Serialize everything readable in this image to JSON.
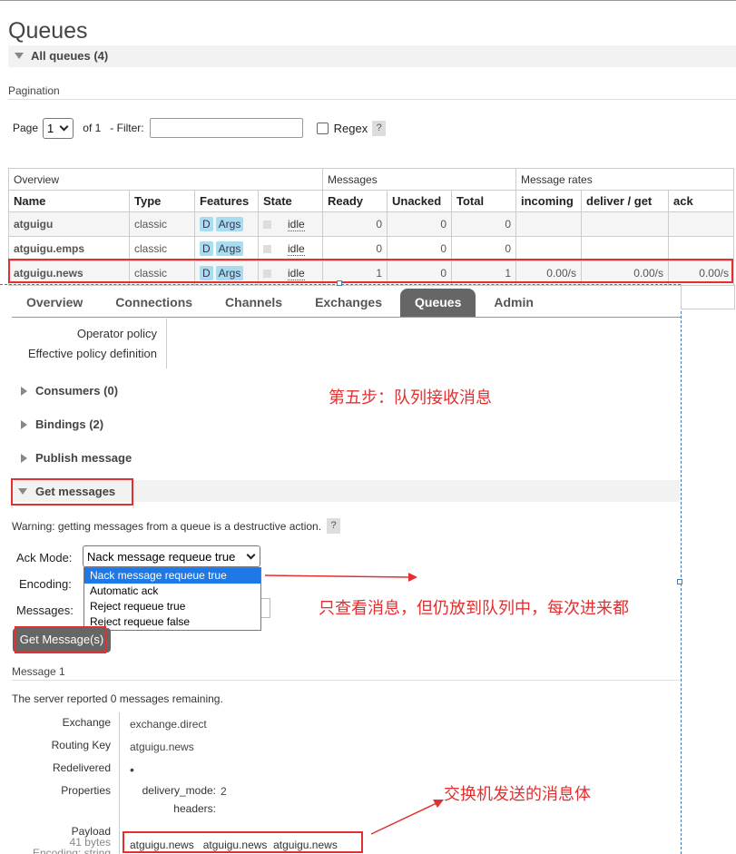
{
  "page": {
    "title": "Queues",
    "all_queues_label": "All queues (4)",
    "pagination_label": "Pagination"
  },
  "pagination": {
    "page_label": "Page",
    "page_value": "1",
    "of_label": "of 1",
    "filter_label": "- Filter:",
    "filter_value": "",
    "regex_label": "Regex",
    "help": "?"
  },
  "table": {
    "groups": [
      "Overview",
      "Messages",
      "Message rates"
    ],
    "headers": [
      "Name",
      "Type",
      "Features",
      "State",
      "Ready",
      "Unacked",
      "Total",
      "incoming",
      "deliver / get",
      "ack"
    ],
    "rows": [
      {
        "name": "atguigu",
        "type": "classic",
        "f1": "D",
        "f2": "Args",
        "state": "idle",
        "ready": "0",
        "unacked": "0",
        "total": "0",
        "incoming": "",
        "deliver": "",
        "ack": ""
      },
      {
        "name": "atguigu.emps",
        "type": "classic",
        "f1": "D",
        "f2": "Args",
        "state": "idle",
        "ready": "0",
        "unacked": "0",
        "total": "0",
        "incoming": "",
        "deliver": "",
        "ack": ""
      },
      {
        "name": "atguigu.news",
        "type": "classic",
        "f1": "D",
        "f2": "Args",
        "state": "idle",
        "ready": "1",
        "unacked": "0",
        "total": "1",
        "incoming": "0.00/s",
        "deliver": "0.00/s",
        "ack": "0.00/s"
      }
    ]
  },
  "nav": {
    "tabs": [
      "Overview",
      "Connections",
      "Channels",
      "Exchanges",
      "Queues",
      "Admin"
    ],
    "active": "Queues"
  },
  "policy": {
    "operator": "Operator policy",
    "effective": "Effective policy definition"
  },
  "sections": {
    "consumers": "Consumers (0)",
    "bindings": "Bindings (2)",
    "publish": "Publish message",
    "get": "Get messages"
  },
  "annotations": {
    "step5": "第五步：队列接收消息",
    "view_only": "只查看消息，但仍放到队列中，每次进来都",
    "exchange_body": "交换机发送的消息体"
  },
  "get_messages": {
    "warning": "Warning: getting messages from a queue is a destructive action.",
    "help": "?",
    "ack_mode_label": "Ack Mode:",
    "ack_mode_value": "Nack message requeue true",
    "options": [
      "Nack message requeue true",
      "Automatic ack",
      "Reject requeue true",
      "Reject requeue false"
    ],
    "encoding_label": "Encoding:",
    "messages_label": "Messages:",
    "button": "Get Message(s)"
  },
  "message": {
    "heading": "Message 1",
    "server_reported_prefix": "The server reported ",
    "remaining_count": "0",
    "server_reported_suffix": " messages remaining.",
    "exchange_key": "Exchange",
    "exchange_value": "exchange.direct",
    "routing_key_key": "Routing Key",
    "routing_key_value": "atguigu.news",
    "redelivered_key": "Redelivered",
    "redelivered_value": "•",
    "properties_key": "Properties",
    "delivery_mode_key": "delivery_mode:",
    "delivery_mode_value": "2",
    "headers_key": "headers:",
    "payload_key": "Payload",
    "payload_bytes": "41 bytes",
    "payload_encoding": "Encoding: string",
    "payload_value": "atguigu.news   atguigu.news  atguigu.news"
  },
  "colors": {
    "highlight": "#e03030",
    "active_tab": "#666666",
    "badge": "#aadcf0",
    "selected_option": "#1e78e6"
  }
}
